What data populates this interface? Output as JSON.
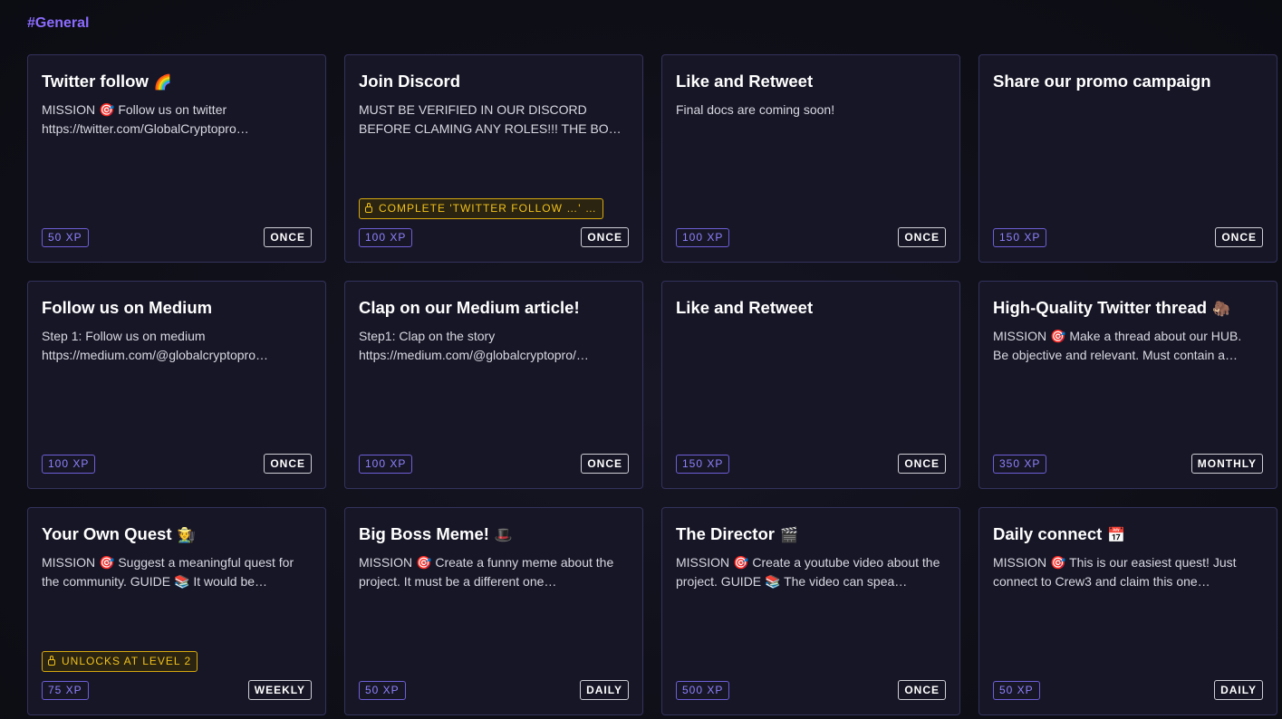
{
  "section": {
    "title": "#General"
  },
  "cards": [
    {
      "title": "Twitter follow",
      "emoji": "🌈",
      "description": "MISSION 🎯 Follow us on twitter\nhttps://twitter.com/GlobalCryptopro…",
      "lock": null,
      "xp": "50 XP",
      "frequency": "ONCE"
    },
    {
      "title": "Join Discord",
      "emoji": "",
      "description": "MUST BE VERIFIED IN OUR DISCORD BEFORE CLAMING ANY ROLES!!! THE BOT WON'T…",
      "lock": "COMPLETE 'TWITTER FOLLOW …' …",
      "xp": "100 XP",
      "frequency": "ONCE"
    },
    {
      "title": "Like and Retweet",
      "emoji": "",
      "description": "Final docs are coming soon!",
      "lock": null,
      "xp": "100 XP",
      "frequency": "ONCE"
    },
    {
      "title": "Share our promo campaign",
      "emoji": "",
      "description": "",
      "lock": null,
      "xp": "150 XP",
      "frequency": "ONCE"
    },
    {
      "title": "Follow us on Medium",
      "emoji": "",
      "description": "Step 1: Follow us on medium\nhttps://medium.com/@globalcryptopro…",
      "lock": null,
      "xp": "100 XP",
      "frequency": "ONCE"
    },
    {
      "title": "Clap on our Medium article!",
      "emoji": "",
      "description": "Step1: Clap on the story\nhttps://medium.com/@globalcryptopro/…",
      "lock": null,
      "xp": "100 XP",
      "frequency": "ONCE"
    },
    {
      "title": "Like and Retweet",
      "emoji": "",
      "description": "",
      "lock": null,
      "xp": "150 XP",
      "frequency": "ONCE"
    },
    {
      "title": "High-Quality Twitter thread",
      "emoji": "🦣",
      "description": "MISSION 🎯 Make a thread about our HUB.\nBe objective and relevant. Must contain a…",
      "lock": null,
      "xp": "350 XP",
      "frequency": "MONTHLY"
    },
    {
      "title": "Your Own Quest",
      "emoji": "🧑‍🌾",
      "description": "MISSION 🎯 Suggest a meaningful quest for the community. GUIDE 📚 It would be…",
      "lock": "UNLOCKS AT LEVEL 2",
      "xp": "75 XP",
      "frequency": "WEEKLY"
    },
    {
      "title": "Big Boss Meme!",
      "emoji": "🎩",
      "description": "MISSION 🎯 Create a funny meme about the project.  It must be a different one…",
      "lock": null,
      "xp": "50 XP",
      "frequency": "DAILY"
    },
    {
      "title": "The Director",
      "emoji": "🎬",
      "description": "MISSION 🎯 Create a youtube video about the project. GUIDE 📚 The video can spea…",
      "lock": null,
      "xp": "500 XP",
      "frequency": "ONCE"
    },
    {
      "title": "Daily connect",
      "emoji": "📅",
      "description": "MISSION 🎯 This is our easiest quest! Just connect to Crew3 and claim this one…",
      "lock": null,
      "xp": "50 XP",
      "frequency": "DAILY"
    }
  ]
}
